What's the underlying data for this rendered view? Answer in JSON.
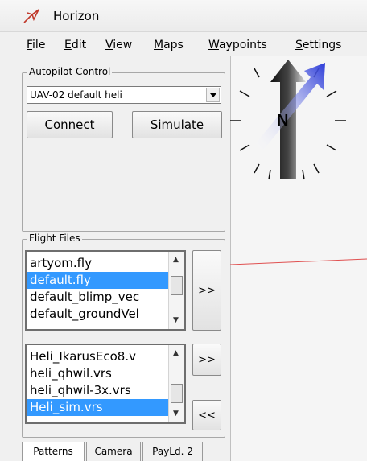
{
  "window": {
    "title": "Horizon"
  },
  "menu": [
    "File",
    "Edit",
    "View",
    "Maps",
    "Waypoints",
    "Settings"
  ],
  "autopilot": {
    "group_label": "Autopilot Control",
    "selected_config": "UAV-02 default heli",
    "connect_label": "Connect",
    "simulate_label": "Simulate"
  },
  "flight_files": {
    "group_label": "Flight Files",
    "fly_files": [
      "artyom.fly",
      "default.fly",
      "default_blimp_vec",
      "default_groundVel"
    ],
    "fly_selected_index": 1,
    "vrs_files": [
      "Heli_IkarusEco8.v",
      "heli_qhwil.vrs",
      "heli_qhwil-3x.vrs",
      "Heli_sim.vrs"
    ],
    "vrs_selected_index": 3,
    "load_button_1": ">>",
    "load_button_2": ">>",
    "unload_button": "<<"
  },
  "tabs": [
    {
      "label": "Patterns",
      "active": true
    },
    {
      "label": "Camera",
      "active": false
    },
    {
      "label": "PayLd. 2",
      "active": false
    }
  ],
  "map": {
    "compass_label": "N",
    "route_line_color": "#e05050",
    "heading_arrow_color": "#2a3ad8"
  },
  "colors": {
    "selection": "#3399ff",
    "window_bg": "#f0f0f0"
  }
}
